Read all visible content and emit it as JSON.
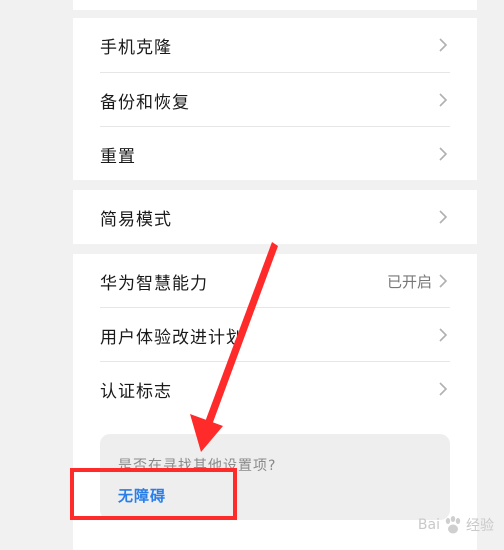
{
  "settings": {
    "group1": [
      {
        "label": "手机克隆",
        "value": ""
      },
      {
        "label": "备份和恢复",
        "value": ""
      },
      {
        "label": "重置",
        "value": ""
      }
    ],
    "group2": [
      {
        "label": "简易模式",
        "value": ""
      }
    ],
    "group3": [
      {
        "label": "华为智慧能力",
        "value": "已开启"
      },
      {
        "label": "用户体验改进计划",
        "value": ""
      },
      {
        "label": "认证标志",
        "value": ""
      }
    ]
  },
  "suggestion": {
    "question": "是否在寻找其他设置项?",
    "link": "无障碍"
  },
  "annotation": {
    "color": "#ff2a2a"
  },
  "watermark": {
    "brand_left": "Bai",
    "brand_right": "经验",
    "icon": "baidu-paw-icon"
  },
  "colors": {
    "link": "#2a7ee8",
    "background": "#f1f1f1",
    "card": "#ffffff"
  }
}
